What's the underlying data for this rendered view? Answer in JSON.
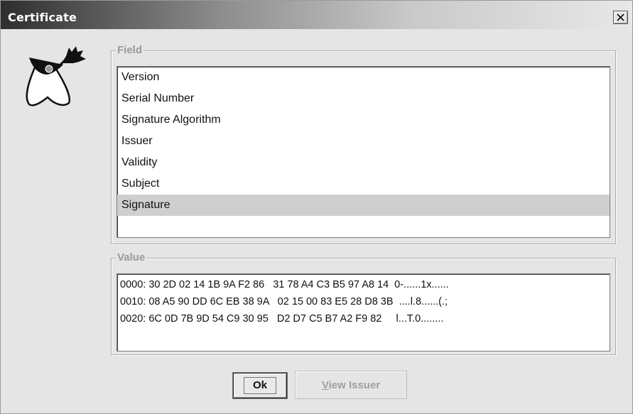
{
  "window": {
    "title": "Certificate"
  },
  "field_section": {
    "legend": "Field",
    "items": [
      {
        "label": "Version",
        "selected": false
      },
      {
        "label": "Serial Number",
        "selected": false
      },
      {
        "label": "Signature Algorithm",
        "selected": false
      },
      {
        "label": "Issuer",
        "selected": false
      },
      {
        "label": "Validity",
        "selected": false
      },
      {
        "label": "Subject",
        "selected": false
      },
      {
        "label": "Signature",
        "selected": true
      }
    ]
  },
  "value_section": {
    "legend": "Value",
    "lines": [
      "0000: 30 2D 02 14 1B 9A F2 86   31 78 A4 C3 B5 97 A8 14  0-......1x......",
      "0010: 08 A5 90 DD 6C EB 38 9A   02 15 00 83 E5 28 D8 3B  ....l.8......(.;",
      "0020: 6C 0D 7B 9D 54 C9 30 95   D2 D7 C5 B7 A2 F9 82     l...T.0........"
    ]
  },
  "buttons": {
    "ok_label": "Ok",
    "view_issuer_mnemonic": "V",
    "view_issuer_rest": "iew Issuer",
    "view_issuer_enabled": false
  },
  "icons": {
    "logo": "java-duke-icon",
    "close": "close-icon"
  },
  "colors": {
    "window_bg": "#e5e5e5",
    "selection_bg": "#cfcfcf",
    "disabled_text": "#a0a0a0",
    "legend_text": "#9a9a9a"
  }
}
